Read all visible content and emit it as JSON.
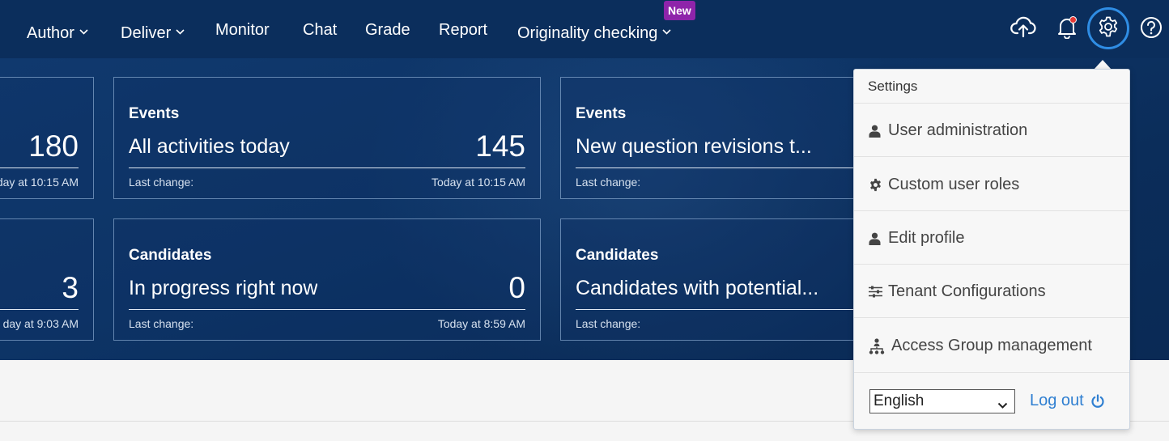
{
  "nav": {
    "items": [
      {
        "label": "Author",
        "has_dropdown": true
      },
      {
        "label": "Deliver",
        "has_dropdown": true
      },
      {
        "label": "Monitor",
        "has_dropdown": false
      },
      {
        "label": "Chat",
        "has_dropdown": false
      },
      {
        "label": "Grade",
        "has_dropdown": false
      },
      {
        "label": "Report",
        "has_dropdown": false
      },
      {
        "label": "Originality checking",
        "has_dropdown": true
      }
    ],
    "new_badge": "New",
    "icons": [
      "cloud-upload-icon",
      "bell-icon",
      "gear-icon",
      "help-icon"
    ]
  },
  "cards": [
    {
      "category": "",
      "label": "",
      "value": "180",
      "last_change_label": "",
      "timestamp": "day at 10:15 AM"
    },
    {
      "category": "Events",
      "label": "All activities today",
      "value": "145",
      "last_change_label": "Last change:",
      "timestamp": "Today at 10:15 AM"
    },
    {
      "category": "Events",
      "label": "New question revisions t...",
      "value": "",
      "last_change_label": "Last change:",
      "timestamp": ""
    },
    {
      "category": "",
      "label": "",
      "value": "3",
      "last_change_label": "",
      "timestamp": "day at 9:03 AM"
    },
    {
      "category": "Candidates",
      "label": "In progress right now",
      "value": "0",
      "last_change_label": "Last change:",
      "timestamp": "Today at 8:59 AM"
    },
    {
      "category": "Candidates",
      "label": "Candidates with potential...",
      "value": "",
      "last_change_label": "Last change:",
      "timestamp": ""
    }
  ],
  "settings_menu": {
    "title": "Settings",
    "items": [
      {
        "label": "User administration",
        "icon": "user-icon"
      },
      {
        "label": "Custom user roles",
        "icon": "cog-icon"
      },
      {
        "label": "Edit profile",
        "icon": "user-icon"
      },
      {
        "label": "Tenant Configurations",
        "icon": "sliders-icon"
      },
      {
        "label": "Access Group management",
        "icon": "hierarchy-icon"
      }
    ],
    "language": "English",
    "logout": "Log out"
  },
  "colors": {
    "nav_bg": "#0b2e5c",
    "badge": "#8e24aa",
    "accent": "#2f7fd1",
    "notification_dot": "#e53935"
  }
}
